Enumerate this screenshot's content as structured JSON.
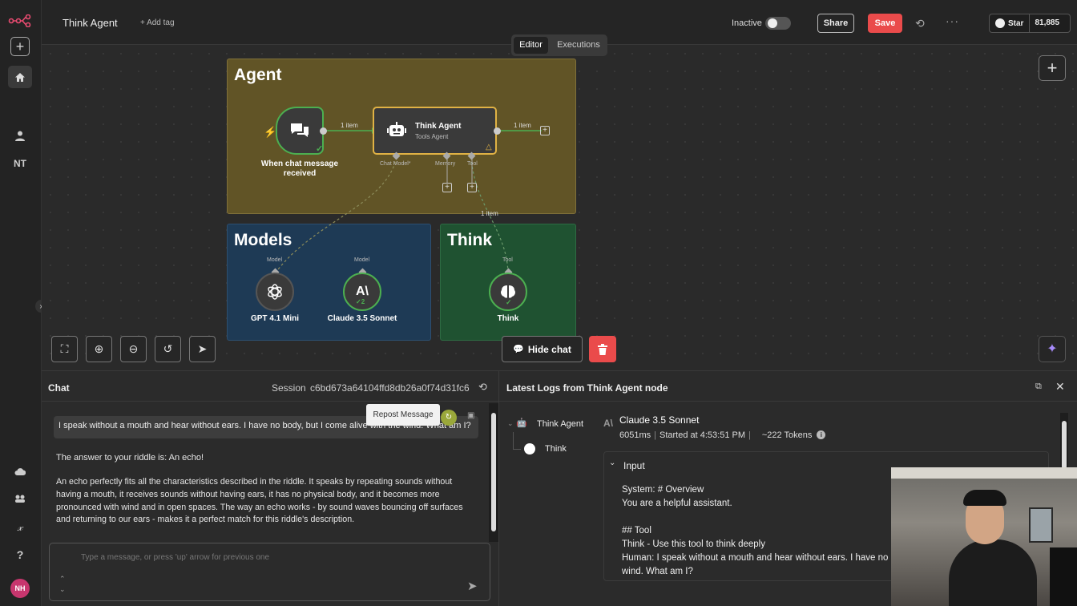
{
  "sidebar": {
    "initials": "NT",
    "avatar": "NH"
  },
  "header": {
    "workflow_name": "Think Agent",
    "add_tag": "+ Add tag",
    "inactive_label": "Inactive",
    "share_label": "Share",
    "save_label": "Save",
    "star_label": "Star",
    "star_count": "81,885"
  },
  "tabs": {
    "editor": "Editor",
    "executions": "Executions"
  },
  "canvas": {
    "agent_group": {
      "title": "Agent",
      "trigger_label": "When chat message received",
      "edge1": "1 item",
      "edge2": "1 item",
      "agent_name": "Think Agent",
      "agent_subtitle": "Tools Agent",
      "port_chat_model": "Chat Model*",
      "port_memory": "Memory",
      "port_tool": "Tool"
    },
    "tool_edge_label": "1 item",
    "models_group": {
      "title": "Models",
      "model1_port": "Model",
      "model1_name": "GPT 4.1 Mini",
      "model2_port": "Model",
      "model2_name": "Claude 3.5 Sonnet",
      "model2_badge": "2"
    },
    "think_group": {
      "title": "Think",
      "tool_port": "Tool",
      "tool_name": "Think"
    },
    "hide_chat": "Hide chat"
  },
  "chat": {
    "title": "Chat",
    "session_label": "Session",
    "session_id": "c6bd673a64104ffd8db26a0f74d31fc6",
    "tooltip": "Repost Message",
    "user_message": "I speak without a mouth and hear without ears. I have no body, but I come alive with the wind. What am I?",
    "reply_line1": "The answer to your riddle is: An echo!",
    "reply_line2": "An echo perfectly fits all the characteristics described in the riddle. It speaks by repeating sounds without having a mouth, it receives sounds without having ears, it has no physical body, and it becomes more pronounced with wind and in open spaces. The way an echo works - by sound waves bouncing off surfaces and returning to our ears - makes it a perfect match for this riddle's description.",
    "input_placeholder": "Type a message, or press 'up' arrow for previous one"
  },
  "logs": {
    "title": "Latest Logs from Think Agent node",
    "tree_agent": "Think Agent",
    "tree_think": "Think",
    "model_name": "Claude 3.5 Sonnet",
    "duration": "6051ms",
    "started": "Started at 4:53:51 PM",
    "tokens": "~222 Tokens",
    "input_label": "Input",
    "lines": [
      "System: # Overview",
      "You are a helpful assistant.",
      "",
      "## Tool",
      "Think - Use this tool to think deeply",
      "Human: I speak without a mouth and hear without ears. I have no body, but I come alive with the",
      "wind. What am I?"
    ]
  },
  "colors": {
    "save": "#ea4b4b",
    "agent_group": "#615426",
    "models_group": "#1e3a55",
    "think_group": "#1f5231",
    "accent_green": "#4caf50"
  }
}
